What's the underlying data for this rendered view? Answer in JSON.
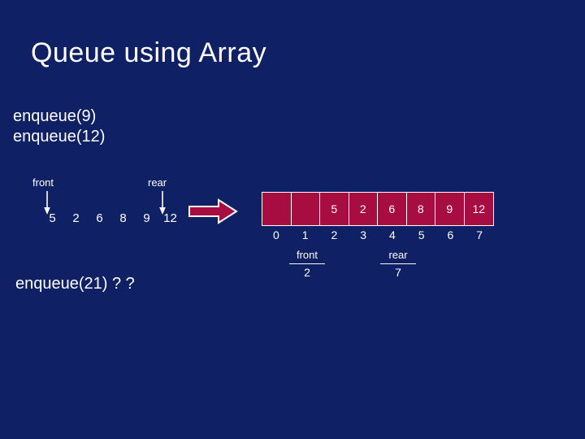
{
  "slide": {
    "title": "Queue using Array",
    "background_color": "#0f2064",
    "text_color": "#ffffff",
    "accent_color": "#a80d41"
  },
  "operations": {
    "lines": [
      "enqueue(9)",
      "enqueue(12)"
    ]
  },
  "logical_queue": {
    "front_label": "front",
    "rear_label": "rear",
    "values": [
      "5",
      "2",
      "6",
      "8",
      "9",
      "12"
    ]
  },
  "flow_arrow": {
    "icon": "right-block-arrow-icon",
    "color": "#a80d41"
  },
  "array": {
    "cells": [
      "",
      "",
      "5",
      "2",
      "6",
      "8",
      "9",
      "12"
    ],
    "indices": [
      "0",
      "1",
      "2",
      "3",
      "4",
      "5",
      "6",
      "7"
    ],
    "front": {
      "label": "front",
      "value": "2"
    },
    "rear": {
      "label": "rear",
      "value": "7"
    }
  },
  "question": {
    "text": "enqueue(21) ? ?"
  }
}
